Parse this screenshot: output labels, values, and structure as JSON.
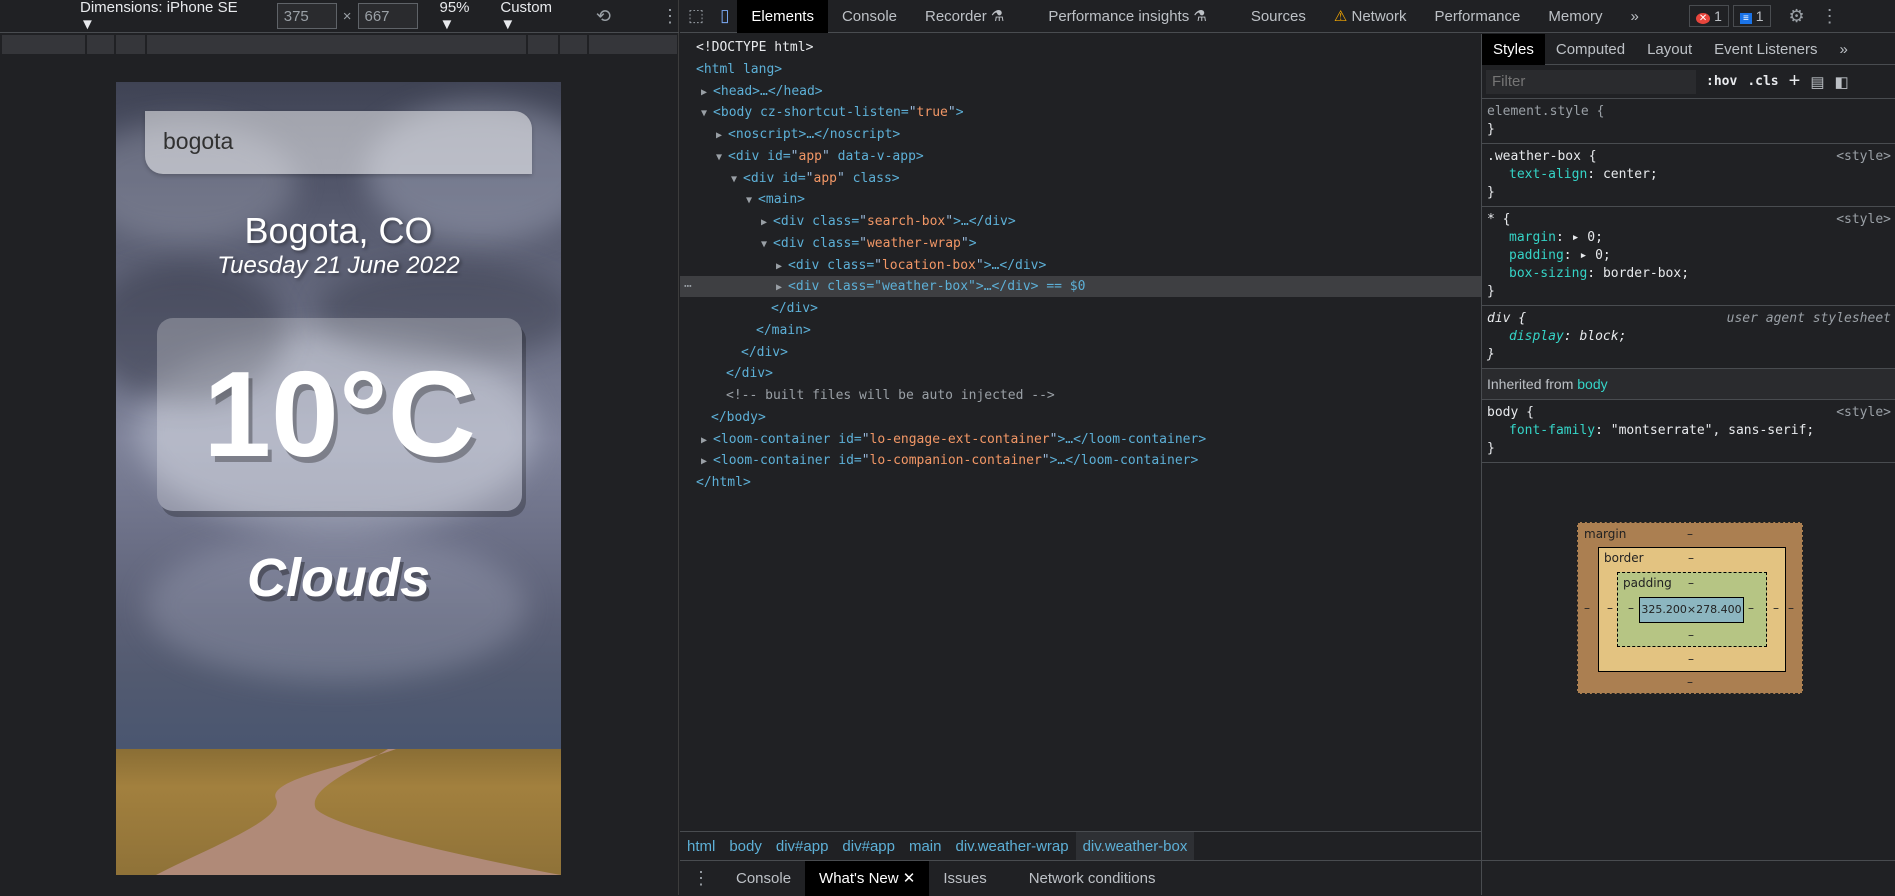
{
  "device_toolbar": {
    "dimensions": "Dimensions: iPhone SE ▼",
    "width": "375",
    "x": "×",
    "height": "667",
    "zoom": "95% ▼",
    "throttle": "Custom ▼"
  },
  "phone": {
    "search_value": "bogota",
    "location": "Bogota, CO",
    "date": "Tuesday 21 June 2022",
    "temperature": "10°C",
    "condition": "Clouds"
  },
  "devtools_tabs": [
    "Elements",
    "Console",
    "Recorder ⚗",
    "Performance insights ⚗",
    "Sources",
    "Network",
    "Performance",
    "Memory",
    "»"
  ],
  "badges": {
    "errors": "1",
    "messages": "1"
  },
  "dom_lines": [
    "<!DOCTYPE html>",
    "<html lang>",
    "<head>…</head>",
    "<body cz-shortcut-listen=\"true\">",
    "<noscript>…</noscript>",
    "<div id=\"app\" data-v-app>",
    "<div id=\"app\" class>",
    "<main>",
    "<div class=\"search-box\">…</div>",
    "<div class=\"weather-wrap\">",
    "<div class=\"location-box\">…</div>",
    "<div class=\"weather-box\">…</div> == $0",
    "</div>",
    "</main>",
    "</div>",
    "</div>",
    "<!-- built files will be auto injected -->",
    "</body>",
    "<loom-container id=\"lo-engage-ext-container\">…</loom-container>",
    "<loom-container id=\"lo-companion-container\">…</loom-container>",
    "</html>"
  ],
  "breadcrumbs": [
    "html",
    "body",
    "div#app",
    "div#app",
    "main",
    "div.weather-wrap",
    "div.weather-box"
  ],
  "drawer_tabs": [
    "Console",
    "What's New",
    "Issues",
    "Network conditions"
  ],
  "styles_tabs": [
    "Styles",
    "Computed",
    "Layout",
    "Event Listeners",
    "»"
  ],
  "styles_filter_placeholder": "Filter",
  "styles_buttons": {
    "hov": ":hov",
    "cls": ".cls",
    "add": "+"
  },
  "rules": {
    "element_style": "element.style {",
    "weather_box": {
      "selector": ".weather-box {",
      "source": "<style>",
      "props": [
        [
          "text-align",
          "center;"
        ]
      ]
    },
    "universal": {
      "selector": "* {",
      "source": "<style>",
      "props": [
        [
          "margin",
          "▸ 0;"
        ],
        [
          "padding",
          "▸ 0;"
        ],
        [
          "box-sizing",
          "border-box;"
        ]
      ]
    },
    "div": {
      "selector": "div {",
      "source": "user agent stylesheet",
      "props": [
        [
          "display",
          "block;"
        ]
      ]
    },
    "inherited_label": "Inherited from",
    "inherited_from": "body",
    "body": {
      "selector": "body {",
      "source": "<style>",
      "props": [
        [
          "font-family",
          "\"montserrate\", sans-serif;"
        ]
      ]
    },
    "close": "}"
  },
  "box_model": {
    "margin": "margin",
    "border": "border",
    "padding": "padding",
    "content": "325.200×278.400",
    "dash": "–"
  }
}
